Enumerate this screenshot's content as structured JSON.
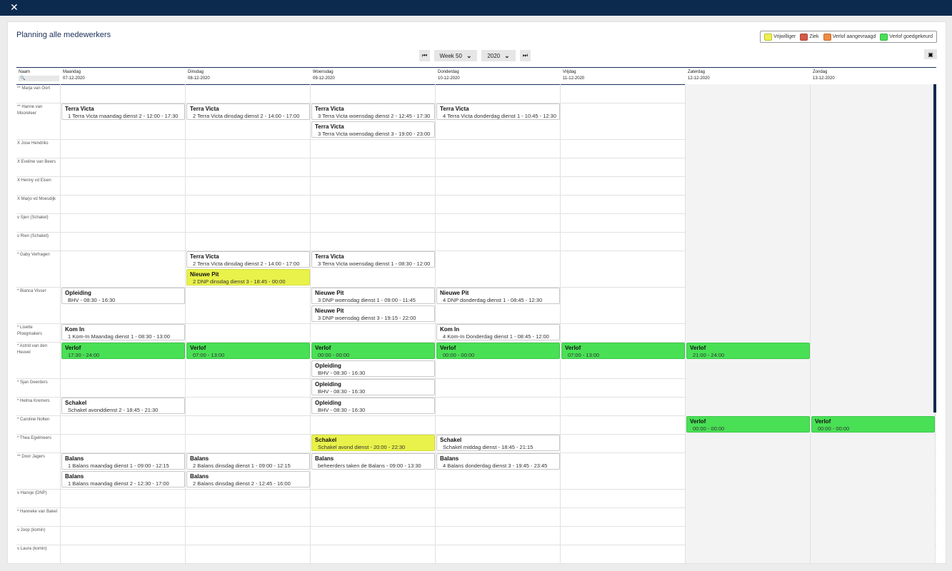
{
  "window": {
    "close_icon": "close-icon"
  },
  "page": {
    "title": "Planning alle medewerkers"
  },
  "legend": [
    {
      "label": "Vrijwilliger",
      "color": "#eef14a"
    },
    {
      "label": "Ziek",
      "color": "#d55a46"
    },
    {
      "label": "Verlof aangevraagd",
      "color": "#f08a42"
    },
    {
      "label": "Verlof goedgekeurd",
      "color": "#49e055"
    }
  ],
  "toolbar": {
    "week": "Week 50",
    "year": "2020"
  },
  "columns": {
    "name_header": "Naam",
    "days": [
      {
        "day": "Maandag",
        "date": "07-12-2020"
      },
      {
        "day": "Dinsdag",
        "date": "08-12-2020"
      },
      {
        "day": "Woensdag",
        "date": "09-12-2020"
      },
      {
        "day": "Donderdag",
        "date": "10-12-2020"
      },
      {
        "day": "Vrijdag",
        "date": "11-12-2020"
      },
      {
        "day": "Zaterdag",
        "date": "12-12-2020"
      },
      {
        "day": "Zondag",
        "date": "13-12-2020"
      }
    ]
  },
  "rows": [
    {
      "name": "** Marja van Oort",
      "height": 26,
      "shifts": []
    },
    {
      "name": "** Hanne van Mooreleer",
      "height": 51,
      "shifts": [
        {
          "day": 0,
          "slot": 0,
          "title": "Terra Victa",
          "detail": "1 Terra Victa maandag dienst 2 - 12:00 - 17:30",
          "kind": "normal"
        },
        {
          "day": 1,
          "slot": 0,
          "title": "Terra Victa",
          "detail": "2 Terra Victa dinsdag dienst 2 - 14:00 - 17:00",
          "kind": "normal"
        },
        {
          "day": 2,
          "slot": 0,
          "title": "Terra Victa",
          "detail": "3 Terra Victa woensdag dienst 2 - 12:45 - 17:30",
          "kind": "normal"
        },
        {
          "day": 2,
          "slot": 1,
          "title": "Terra Victa",
          "detail": "3 Terra Victa woensdag dienst 3 - 19:00 - 23:00",
          "kind": "normal"
        },
        {
          "day": 3,
          "slot": 0,
          "title": "Terra Victa",
          "detail": "4 Terra Victa donderdag dienst 1 - 10:45 - 12:30",
          "kind": "normal"
        }
      ]
    },
    {
      "name": "X Jose Hendriks",
      "height": 26,
      "shifts": []
    },
    {
      "name": "X Eveline van Beers",
      "height": 26,
      "shifts": []
    },
    {
      "name": "X Henny vd Eisen",
      "height": 26,
      "shifts": []
    },
    {
      "name": "X Marjo vd Moesdijk",
      "height": 26,
      "shifts": []
    },
    {
      "name": "v Sjen (Schakel)",
      "height": 26,
      "shifts": []
    },
    {
      "name": "v Rien (Schakel)",
      "height": 26,
      "shifts": []
    },
    {
      "name": "* Gaby Verhagen",
      "height": 51,
      "shifts": [
        {
          "day": 1,
          "slot": 0,
          "title": "Terra Victa",
          "detail": "2 Terra Victa dinsdag dienst 2 - 14:00 - 17:00",
          "kind": "normal"
        },
        {
          "day": 1,
          "slot": 1,
          "title": "Nieuwe Pit",
          "detail": "2 DNP dinsdag dienst 3 - 18:45 - 00:00",
          "kind": "vol"
        },
        {
          "day": 2,
          "slot": 0,
          "title": "Terra Victa",
          "detail": "3 Terra Victa woensdag dienst 1 - 08:30 - 12:00",
          "kind": "normal"
        }
      ]
    },
    {
      "name": "* Bianca Visser",
      "height": 51,
      "shifts": [
        {
          "day": 0,
          "slot": 0,
          "title": "Opleiding",
          "detail": "BHV - 08:30 - 16:30",
          "kind": "normal"
        },
        {
          "day": 2,
          "slot": 0,
          "title": "Nieuwe Pit",
          "detail": "3 DNP woensdag dienst 1 - 09:00 - 11:45",
          "kind": "normal"
        },
        {
          "day": 2,
          "slot": 1,
          "title": "Nieuwe Pit",
          "detail": "3 DNP woensdag dienst 3 - 19:15 - 22:00",
          "kind": "normal"
        },
        {
          "day": 3,
          "slot": 0,
          "title": "Nieuwe Pit",
          "detail": "4 DNP donderdag dienst 1 - 08:45 - 12:30",
          "kind": "normal"
        }
      ]
    },
    {
      "name": "* Lisette Ploegmakers",
      "height": 26,
      "shifts": [
        {
          "day": 0,
          "slot": 0,
          "title": "Kom In",
          "detail": "1 Kom-In Maandag dienst 1 - 08:30 - 13:00",
          "kind": "normal"
        },
        {
          "day": 3,
          "slot": 0,
          "title": "Kom In",
          "detail": "4 Kom-In Donderdag dienst 1 - 08:45 - 12:00",
          "kind": "normal"
        }
      ]
    },
    {
      "name": "* Astrid van den Heuvel",
      "height": 51,
      "shifts": [
        {
          "day": 0,
          "slot": 0,
          "title": "Verlof",
          "detail": "17:30 - 24:00",
          "kind": "leave"
        },
        {
          "day": 1,
          "slot": 0,
          "title": "Verlof",
          "detail": "07:00 - 13:00",
          "kind": "leave"
        },
        {
          "day": 2,
          "slot": 0,
          "title": "Verlof",
          "detail": "00:00 - 00:00",
          "kind": "leave"
        },
        {
          "day": 2,
          "slot": 1,
          "title": "Opleiding",
          "detail": "BHV - 08:30 - 16:30",
          "kind": "normal"
        },
        {
          "day": 3,
          "slot": 0,
          "title": "Verlof",
          "detail": "00:00 - 00:00",
          "kind": "leave"
        },
        {
          "day": 4,
          "slot": 0,
          "title": "Verlof",
          "detail": "07:00 - 13:00",
          "kind": "leave"
        },
        {
          "day": 5,
          "slot": 0,
          "title": "Verlof",
          "detail": "21:00 - 24:00",
          "kind": "leave"
        }
      ]
    },
    {
      "name": "* Sjan Geerders",
      "height": 26,
      "shifts": [
        {
          "day": 2,
          "slot": 0,
          "title": "Opleiding",
          "detail": "BHV - 08:30 - 16:30",
          "kind": "normal"
        }
      ]
    },
    {
      "name": "* Helma Kremers",
      "height": 26,
      "shifts": [
        {
          "day": 0,
          "slot": 0,
          "title": "Schakel",
          "detail": "Schakel avonddienst 2 - 18:45 - 21:30",
          "kind": "normal"
        },
        {
          "day": 2,
          "slot": 0,
          "title": "Opleiding",
          "detail": "BHV - 08:30 - 16:30",
          "kind": "normal"
        }
      ]
    },
    {
      "name": "* Caroline Nolten",
      "height": 26,
      "shifts": [
        {
          "day": 5,
          "slot": 0,
          "title": "Verlof",
          "detail": "00:00 - 00:00",
          "kind": "leave"
        },
        {
          "day": 6,
          "slot": 0,
          "title": "Verlof",
          "detail": "00:00 - 00:00",
          "kind": "leave"
        }
      ]
    },
    {
      "name": "* Thea Egelmeers",
      "height": 26,
      "shifts": [
        {
          "day": 2,
          "slot": 0,
          "title": "Schakel",
          "detail": "Schakel avond dienst - 20:00 - 22:30",
          "kind": "vol"
        },
        {
          "day": 3,
          "slot": 0,
          "title": "Schakel",
          "detail": "Schakel middag dienst - 18:45 - 21:15",
          "kind": "normal"
        }
      ]
    },
    {
      "name": "** Door Jagers",
      "height": 51,
      "shifts": [
        {
          "day": 0,
          "slot": 0,
          "title": "Balans",
          "detail": "1 Balans maandag dienst 1 - 09:00 - 12:15",
          "kind": "normal"
        },
        {
          "day": 0,
          "slot": 1,
          "title": "Balans",
          "detail": "1 Balans maandag dienst 2 - 12:30 - 17:00",
          "kind": "normal"
        },
        {
          "day": 1,
          "slot": 0,
          "title": "Balans",
          "detail": "2 Balans dinsdag dienst 1 - 09:00 - 12:15",
          "kind": "normal"
        },
        {
          "day": 1,
          "slot": 1,
          "title": "Balans",
          "detail": "2 Balans dinsdag dienst 2 - 12:45 - 16:00",
          "kind": "normal"
        },
        {
          "day": 2,
          "slot": 0,
          "title": "Balans",
          "detail": "beheerders taken de Balans - 09:00 - 13:30",
          "kind": "normal"
        },
        {
          "day": 3,
          "slot": 0,
          "title": "Balans",
          "detail": "4 Balans donderdag dienst 3 - 19:45 - 23:45",
          "kind": "normal"
        }
      ]
    },
    {
      "name": "v Hansje (DNP)",
      "height": 26,
      "shifts": []
    },
    {
      "name": "* Hanneke van Bakel",
      "height": 26,
      "shifts": []
    },
    {
      "name": "v Joop (komin)",
      "height": 26,
      "shifts": []
    },
    {
      "name": "v Laura (komin)",
      "height": 26,
      "shifts": []
    }
  ]
}
